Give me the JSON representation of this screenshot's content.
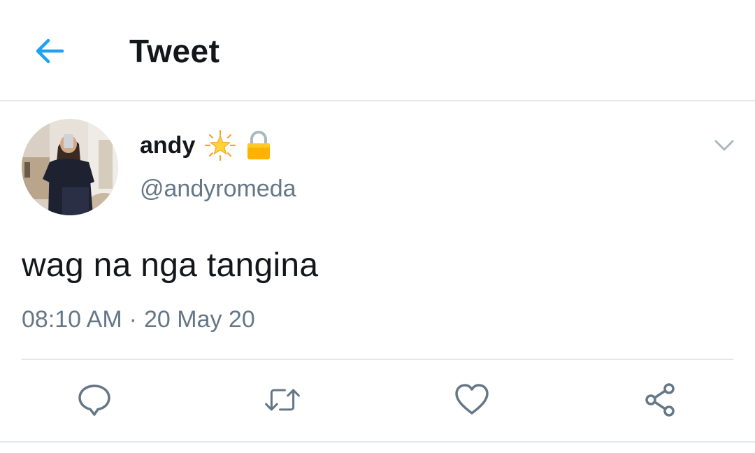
{
  "header": {
    "title": "Tweet"
  },
  "tweet": {
    "author": {
      "display_name": "andy",
      "handle": "@andyromeda",
      "badges": [
        "sparkle-star-emoji",
        "lock-emoji"
      ]
    },
    "text": "wag na nga tangina",
    "time": "08:10 AM",
    "separator": "·",
    "date": "20 May 20"
  },
  "actions": [
    "reply",
    "retweet",
    "like",
    "share"
  ],
  "colors": {
    "accent": "#1da1f2",
    "secondary_text": "#657786",
    "divider": "#e1e8ed",
    "icon": "#657786"
  }
}
